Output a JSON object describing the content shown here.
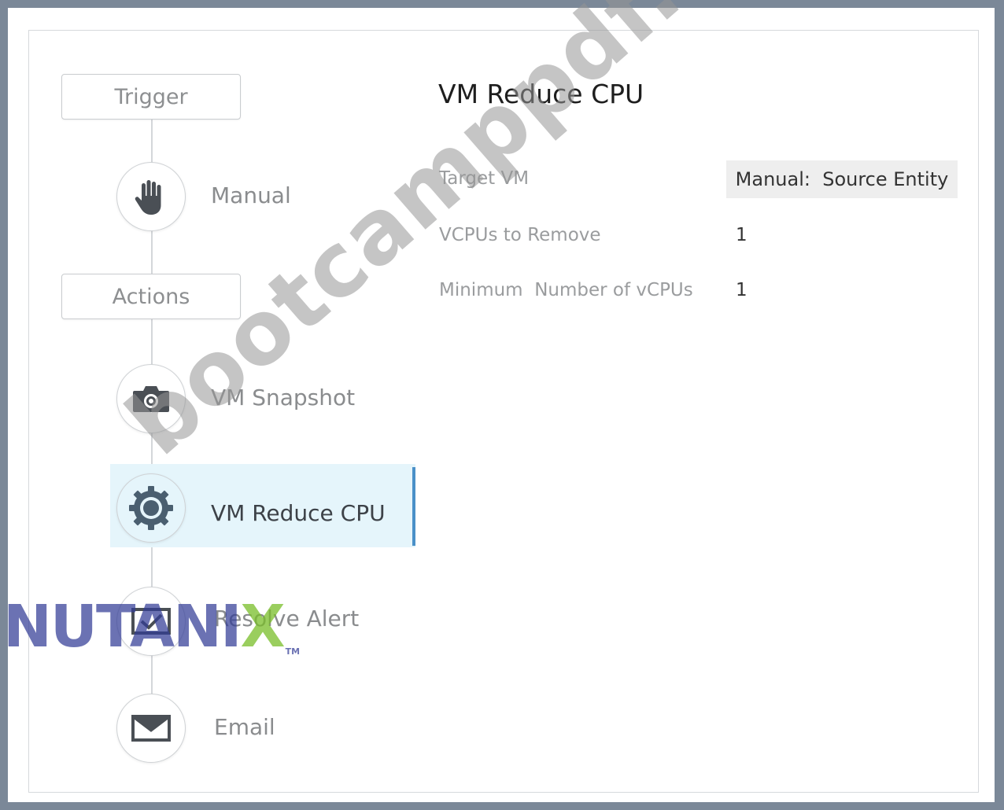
{
  "pipeline": {
    "trigger_label": "Trigger",
    "actions_label": "Actions",
    "steps": [
      {
        "label": "Manual",
        "icon": "hand-icon"
      },
      {
        "label": "VM Snapshot",
        "icon": "camera-icon"
      },
      {
        "label": "VM Reduce CPU",
        "icon": "gear-icon"
      },
      {
        "label": "Resolve Alert",
        "icon": "check-envelope-icon"
      },
      {
        "label": "Email",
        "icon": "envelope-icon"
      }
    ]
  },
  "detail": {
    "title": "VM Reduce CPU",
    "fields": [
      {
        "label": "Target VM",
        "value": "Manual:  Source Entity"
      },
      {
        "label": "VCPUs to Remove",
        "value": "1"
      },
      {
        "label": "Minimum  Number of vCPUs",
        "value": "1"
      }
    ]
  },
  "watermark": "bootcamppdf.com",
  "logo": {
    "text": "NUTANI",
    "x_letter": "X",
    "tm": "TM"
  },
  "colors": {
    "accent": "#4a90c8",
    "selected_bg": "#e5f5fb",
    "frame": "#7b8898",
    "icon": "#4a4f55"
  }
}
